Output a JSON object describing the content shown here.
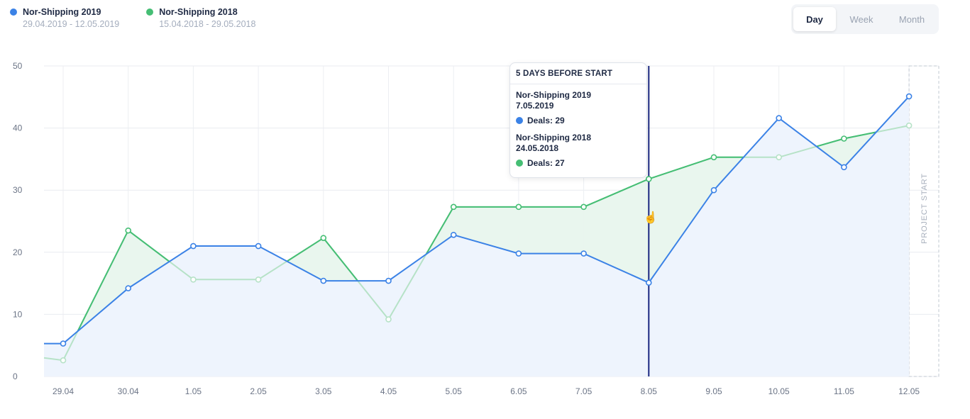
{
  "legend": [
    {
      "name": "Nor-Shipping 2019",
      "dates": "29.04.2019 - 12.05.2019",
      "color": "#3b82e6"
    },
    {
      "name": "Nor-Shipping 2018",
      "dates": "15.04.2018 - 29.05.2018",
      "color": "#45be74"
    }
  ],
  "toggle": {
    "day": "Day",
    "week": "Week",
    "month": "Month",
    "selected": "Day"
  },
  "tooltip": {
    "title": "5 DAYS BEFORE START",
    "entries": [
      {
        "name": "Nor-Shipping 2019",
        "date": "7.05.2019",
        "deals": "Deals: 29",
        "color": "#3b82e6"
      },
      {
        "name": "Nor-Shipping 2018",
        "date": "24.05.2018",
        "deals": "Deals: 27",
        "color": "#45be74"
      }
    ]
  },
  "project_start_label": "PROJECT START",
  "cursor_icon": "hand-pointer-icon",
  "chart_data": {
    "type": "line",
    "categories": [
      "29.04",
      "30.04",
      "1.05",
      "2.05",
      "3.05",
      "4.05",
      "5.05",
      "6.05",
      "7.05",
      "8.05",
      "9.05",
      "10.05",
      "11.05",
      "12.05"
    ],
    "series": [
      {
        "name": "Nor-Shipping 2019",
        "color": "#3b82e6",
        "values": [
          5.3,
          14.2,
          21,
          21,
          15.4,
          15.4,
          22.8,
          19.8,
          19.8,
          15.1,
          30,
          41.6,
          33.7,
          45.1
        ],
        "start_value": 5.3
      },
      {
        "name": "Nor-Shipping 2018",
        "color": "#45be74",
        "values": [
          2.6,
          23.5,
          15.6,
          15.6,
          22.3,
          9.2,
          27.3,
          27.3,
          27.3,
          31.8,
          35.3,
          35.3,
          38.3,
          40.4
        ],
        "start_value": 3
      }
    ],
    "ylim": [
      0,
      50
    ],
    "yticks": [
      0,
      10,
      20,
      30,
      40,
      50
    ],
    "highlight_category": "8.05",
    "grid": true
  }
}
